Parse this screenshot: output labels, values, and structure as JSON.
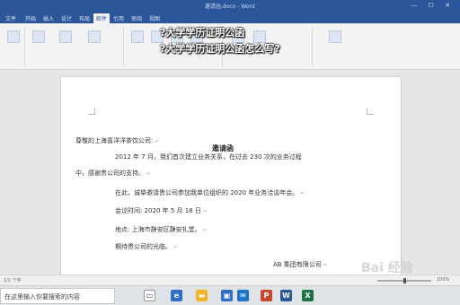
{
  "window": {
    "title": "邀请函.docx  -  Word"
  },
  "ribbon": {
    "tabs": [
      "文件",
      "开始",
      "插入",
      "设计",
      "布局",
      "引用",
      "邮件",
      "审阅",
      "视图"
    ],
    "active_tab": "邮件"
  },
  "overlay": {
    "line1": "?大学学历证明公函",
    "line2": "?大学学历证明公函怎么写?"
  },
  "document": {
    "title": "邀请函",
    "salutation": "尊敬的上海喜洋洋茶饮公司:",
    "para1_line1": "2012 年 7 月，我们首次建立业务关系，在过去 230 次的业务过程",
    "para1_line2": "中，感谢贵公司的支持。",
    "para2": "在此，诚挚邀请贵公司参加我单位组织的 2020 年业务洽谈年会。",
    "meeting_time": "会议时间: 2020 年 5 月 18 日",
    "location": "地点: 上海市静安区静安礼堂。",
    "closing": "期待贵公司的光临。",
    "signature": "AB 集团有限公司",
    "para_mark": "↵"
  },
  "statusbar": {
    "pages": "1/1 个字",
    "zoom": "100%",
    "zoom_fraction": 0.5
  },
  "taskbar": {
    "search_text": "在这里输入你要搜索的内容",
    "apps": [
      "file-explorer-icon",
      "edge-icon",
      "store-icon",
      "mail-icon",
      "powerpoint-icon",
      "word-icon",
      "excel-icon"
    ]
  },
  "watermark": {
    "text": "Bai 经验"
  },
  "colors": {
    "ribbon": "#2b579a",
    "page": "#ffffff",
    "canvas": "#e6e6e6"
  }
}
